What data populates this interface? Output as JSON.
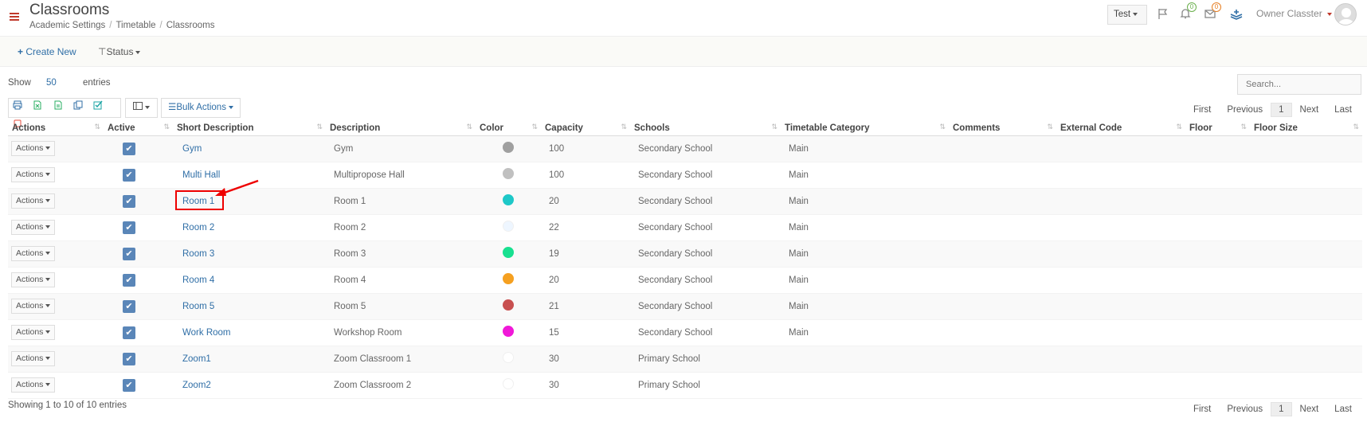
{
  "header": {
    "title": "Classrooms",
    "breadcrumb": [
      "Academic Settings",
      "Timetable",
      "Classrooms"
    ],
    "school_selector": "Test",
    "notif_badge": "0",
    "mail_badge": "0",
    "user_name": "Owner Classter"
  },
  "toolbar": {
    "create_new": "Create New",
    "status": "Status"
  },
  "list_controls": {
    "show_label": "Show",
    "page_size": "50",
    "entries_label": "entries",
    "search_placeholder": "Search...",
    "bulk_actions": "Bulk Actions"
  },
  "pager": {
    "first": "First",
    "previous": "Previous",
    "current": "1",
    "next": "Next",
    "last": "Last"
  },
  "table": {
    "columns": [
      "Actions",
      "Active",
      "Short Description",
      "Description",
      "Color",
      "Capacity",
      "Schools",
      "Timetable Category",
      "Comments",
      "External Code",
      "Floor",
      "Floor Size"
    ],
    "action_label": "Actions",
    "rows": [
      {
        "short": "Gym",
        "desc": "Gym",
        "color": "#a0a0a0",
        "capacity": "100",
        "school": "Secondary School",
        "category": "Main"
      },
      {
        "short": "Multi Hall",
        "desc": "Multipropose Hall",
        "color": "#c0c0c0",
        "capacity": "100",
        "school": "Secondary School",
        "category": "Main"
      },
      {
        "short": "Room 1",
        "desc": "Room 1",
        "color": "#1ec8c8",
        "capacity": "20",
        "school": "Secondary School",
        "category": "Main"
      },
      {
        "short": "Room 2",
        "desc": "Room 2",
        "color": "#eef6ff",
        "capacity": "22",
        "school": "Secondary School",
        "category": "Main"
      },
      {
        "short": "Room 3",
        "desc": "Room 3",
        "color": "#18e090",
        "capacity": "19",
        "school": "Secondary School",
        "category": "Main"
      },
      {
        "short": "Room 4",
        "desc": "Room 4",
        "color": "#f5a020",
        "capacity": "20",
        "school": "Secondary School",
        "category": "Main"
      },
      {
        "short": "Room 5",
        "desc": "Room 5",
        "color": "#c85050",
        "capacity": "21",
        "school": "Secondary School",
        "category": "Main"
      },
      {
        "short": "Work Room",
        "desc": "Workshop Room",
        "color": "#f018d8",
        "capacity": "15",
        "school": "Secondary School",
        "category": "Main"
      },
      {
        "short": "Zoom1",
        "desc": "Zoom Classroom 1",
        "color": "#ffffff",
        "capacity": "30",
        "school": "Primary School",
        "category": ""
      },
      {
        "short": "Zoom2",
        "desc": "Zoom Classroom 2",
        "color": "#ffffff",
        "capacity": "30",
        "school": "Primary School",
        "category": ""
      }
    ]
  },
  "footer": {
    "info": "Showing 1 to 10 of 10 entries"
  },
  "colors": {
    "accent": "#2f6ea6",
    "brand_red": "#c0392b",
    "checkbox": "#5a86b8"
  }
}
